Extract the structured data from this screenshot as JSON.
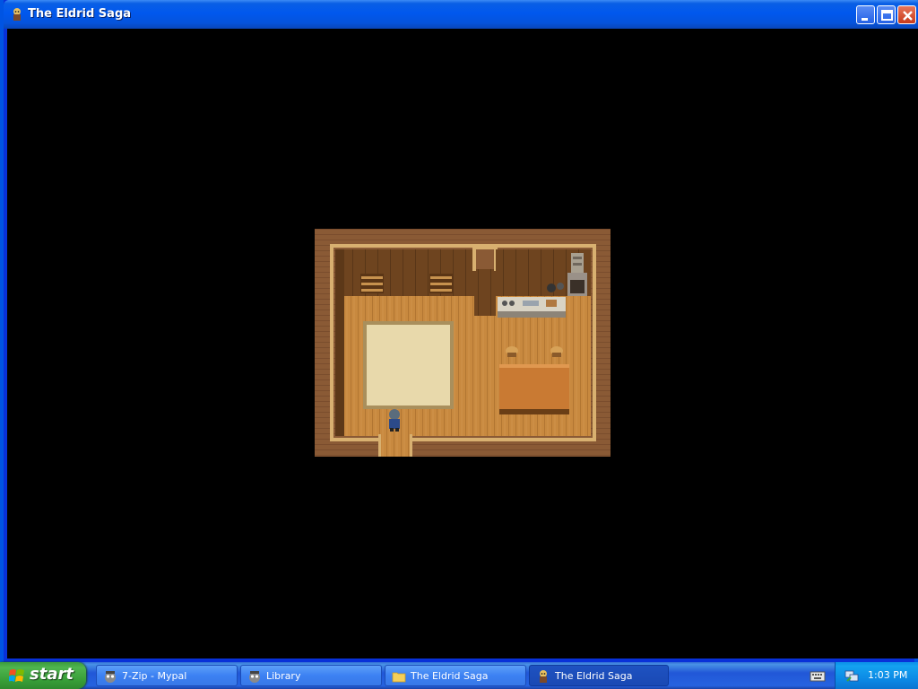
{
  "window": {
    "title": "The Eldrid Saga",
    "title_icon": "game-app-icon",
    "buttons": [
      "minimize-icon",
      "maximize-icon",
      "close-icon"
    ]
  },
  "game": {
    "scene": "wooden-house-interior",
    "player": "player-character-sprite"
  },
  "taskbar": {
    "start_label": "start",
    "tasks": [
      {
        "label": "7-Zip - Mypal",
        "icon": "mypal-icon",
        "active": false
      },
      {
        "label": "Library",
        "icon": "mypal-icon",
        "active": false
      },
      {
        "label": "The Eldrid Saga",
        "icon": "folder-icon",
        "active": false
      },
      {
        "label": "The Eldrid Saga",
        "icon": "game-app-icon",
        "active": true
      }
    ],
    "clock": "1:03 PM"
  },
  "colors": {
    "titlebar": "#0058ee",
    "taskbar": "#2157d7",
    "start": "#379d37",
    "tray": "#0b86e3",
    "floor": "#c88a44",
    "wall": "#6b4220",
    "rug": "#e6d6a8"
  }
}
